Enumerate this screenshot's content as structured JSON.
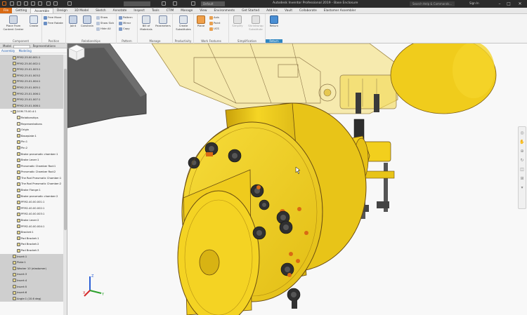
{
  "titlebar": {
    "doc_tab": "Default",
    "title": "Autodesk Inventor Professional 2019 - Base Enclosure",
    "search": "Search Help & Commands...",
    "user": "Sign In",
    "controls": [
      "–",
      "□",
      "✕"
    ]
  },
  "tabs": [
    "File",
    "Getting",
    "Assemble",
    "Design",
    "3D Model",
    "Sketch",
    "Annotate",
    "Inspect",
    "Tools",
    "CTIM",
    "Manage",
    "View",
    "Environments",
    "Get Started",
    "Add-Ins",
    "Vault",
    "Collaborate",
    "Elastomer Assembler"
  ],
  "ribbon": {
    "component": {
      "place": "Place From Content Center",
      "create": "Create",
      "place_small": "Place",
      "free_move": "Free Move",
      "free_rotate": "Free Rotate",
      "title": "Component",
      "position_title": "Position"
    },
    "relationships": {
      "joint": "Joint",
      "constrain": "Constrain",
      "show": "Show",
      "show_sick": "Show Sick",
      "hide_all": "Hide All",
      "title": "Relationships"
    },
    "pattern": {
      "pattern": "Pattern",
      "mirror": "Mirror",
      "copy": "Copy",
      "title": "Pattern"
    },
    "manage": {
      "bom": "Bill of Materials",
      "parameters": "Parameters",
      "title": "Manage"
    },
    "productivity": {
      "create_sub": "Create Substitutes",
      "title": "Productivity"
    },
    "work_features": {
      "plane": "Plane",
      "axis": "Axis",
      "point": "Point",
      "ucs": "UCS",
      "title": "Work Features"
    },
    "simplification": {
      "simplify": "Simplify",
      "shrinkwrap": "Shrinkwrap Substitute",
      "title": "Simplification"
    },
    "return": {
      "label": "Return",
      "title": "Return"
    }
  },
  "browser": {
    "tabs": [
      "Model",
      "Representations"
    ],
    "sub": [
      "Assembly",
      "Modeling"
    ],
    "rows": [
      {
        "label": "PFM2.25.00.001:1",
        "sel": true
      },
      {
        "label": "PFM2.25.00.002:1",
        "sel": true
      },
      {
        "label": "PFM2.25.01.003:1",
        "sel": true
      },
      {
        "label": "PFM2.25.01.003:2",
        "sel": true
      },
      {
        "label": "PFM2.25.01.004:1",
        "sel": true
      },
      {
        "label": "PFM2.25.01.005:1",
        "sel": true
      },
      {
        "label": "PFM2.25.01.006:1",
        "sel": true
      },
      {
        "label": "PFM2.25.01.007:1",
        "sel": true
      },
      {
        "label": "PFM2.25.01.008:1",
        "sel": true
      },
      {
        "label": "DOM.75.00.4:1",
        "sel": false
      },
      {
        "label": "Relationships",
        "sel": false
      },
      {
        "label": "Representations",
        "sel": false
      },
      {
        "label": "Origin",
        "sel": false
      },
      {
        "label": "Baseplate:1",
        "sel": false
      },
      {
        "label": "Pin:1",
        "sel": false
      },
      {
        "label": "Pin:2",
        "sel": false
      },
      {
        "label": "Brake pneumatic chamber:1",
        "sel": false
      },
      {
        "label": "Brake Lever:1",
        "sel": false
      },
      {
        "label": "Pneumatic Chamber Rod:1",
        "sel": false
      },
      {
        "label": "Pneumatic Chamber Rod:2",
        "sel": false
      },
      {
        "label": "The Rod Pneumatic Chamber:1",
        "sel": false
      },
      {
        "label": "The Rod Pneumatic Chamber:2",
        "sel": false
      },
      {
        "label": "Brake Flange:1",
        "sel": false
      },
      {
        "label": "Brake pneumatic chamber:2",
        "sel": false
      },
      {
        "label": "PFM2.40.00.001:1",
        "sel": false
      },
      {
        "label": "PFM2.40.00.002:1",
        "sel": false
      },
      {
        "label": "PFM2.40.00.003:1",
        "sel": false
      },
      {
        "label": "Brake Lever:2",
        "sel": false
      },
      {
        "label": "PFM2.40.00.004:1",
        "sel": false
      },
      {
        "label": "Bracket:1",
        "sel": false
      },
      {
        "label": "Pad Bracket:1",
        "sel": false
      },
      {
        "label": "Pad Bracket:2",
        "sel": false
      },
      {
        "label": "Pad Bracket:3",
        "sel": false
      },
      {
        "label": "Insert:1",
        "sel": true
      },
      {
        "label": "Plate:1",
        "sel": true
      },
      {
        "label": "Washer 10 (elastomer)",
        "sel": true
      },
      {
        "label": "Insert:3",
        "sel": true
      },
      {
        "label": "Insert:4",
        "sel": true
      },
      {
        "label": "Insert:5",
        "sel": true
      },
      {
        "label": "Insert:6",
        "sel": true
      },
      {
        "label": "Angle:1 (10.6 deg)",
        "sel": true
      }
    ]
  },
  "triad": {
    "x": "X",
    "y": "Y",
    "z": "Z"
  },
  "colors": {
    "part": "#f2cf1d",
    "part_dark": "#c9a10a",
    "outline": "#6b4d10",
    "accent": "#d96a14",
    "bolt": "#3a3a3a"
  }
}
